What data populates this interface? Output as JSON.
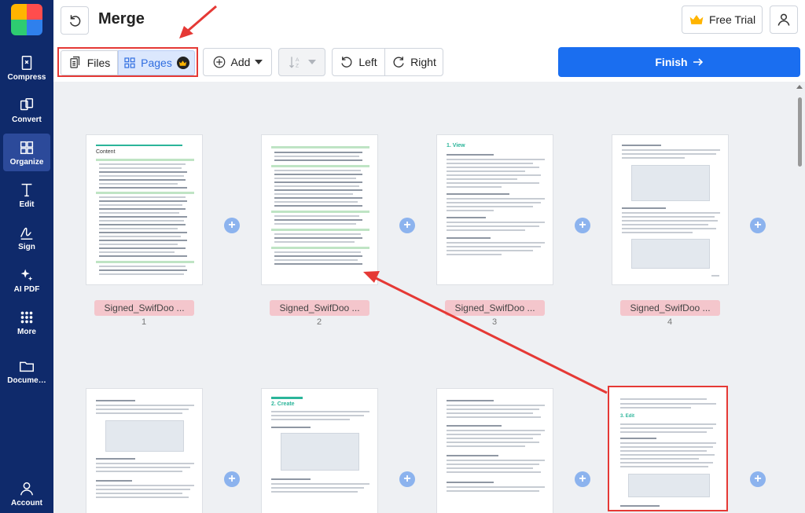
{
  "sidebar": {
    "items": [
      {
        "label": "Compress",
        "icon": "compress-icon"
      },
      {
        "label": "Convert",
        "icon": "convert-icon"
      },
      {
        "label": "Organize",
        "icon": "organize-icon",
        "active": true
      },
      {
        "label": "Edit",
        "icon": "edit-text-icon"
      },
      {
        "label": "Sign",
        "icon": "signature-icon"
      },
      {
        "label": "AI PDF",
        "icon": "sparkle-icon"
      },
      {
        "label": "More",
        "icon": "grid-dots-icon"
      },
      {
        "label": "Docume…",
        "icon": "folder-icon"
      }
    ],
    "account_label": "Account"
  },
  "header": {
    "title": "Merge",
    "free_trial_label": "Free Trial"
  },
  "toolbar": {
    "files_label": "Files",
    "pages_label": "Pages",
    "add_label": "Add",
    "sort_icon": "sort-az-icon",
    "rotate_left_label": "Left",
    "rotate_right_label": "Right",
    "finish_label": "Finish"
  },
  "pages": [
    {
      "file": "Signed_SwifDoo ...",
      "number": "1"
    },
    {
      "file": "Signed_SwifDoo ...",
      "number": "2"
    },
    {
      "file": "Signed_SwifDoo ...",
      "number": "3"
    },
    {
      "file": "Signed_SwifDoo ...",
      "number": "4"
    }
  ],
  "page_text": {
    "p1_heading": "Content",
    "p3_heading": "1. View",
    "p6_heading": "2. Create",
    "p8_heading": "3. Edit"
  },
  "colors": {
    "sidebar_bg": "#0f2a6b",
    "accent": "#1a6ef0",
    "highlight": "#e53935",
    "label_bg": "#f4c6cc"
  }
}
